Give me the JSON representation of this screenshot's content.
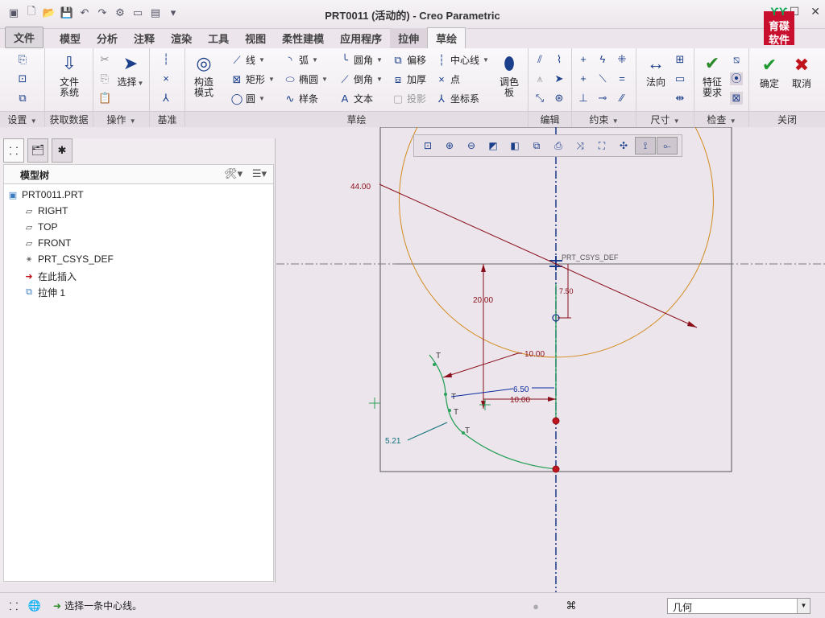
{
  "window": {
    "title": "PRT0011 (活动的) - Creo Parametric"
  },
  "logo": {
    "text": "育碟软件"
  },
  "tabs": [
    {
      "label": "文件",
      "kind": "file"
    },
    {
      "label": "模型"
    },
    {
      "label": "分析"
    },
    {
      "label": "注释"
    },
    {
      "label": "渲染"
    },
    {
      "label": "工具"
    },
    {
      "label": "视图"
    },
    {
      "label": "柔性建模"
    },
    {
      "label": "应用程序"
    },
    {
      "label": "拉伸",
      "kind": "ctx"
    },
    {
      "label": "草绘",
      "kind": "active"
    }
  ],
  "ribbon": {
    "groups": {
      "setup": "设置",
      "getdata": "获取数据",
      "ops": "操作",
      "datum": "基准",
      "sketch": "草绘",
      "edit": "编辑",
      "constrain": "约束",
      "dimension": "尺寸",
      "inspect": "检查",
      "close": "关闭"
    },
    "buttons": {
      "file_system": "文件\n系统",
      "select": "选择",
      "construction": "构造\n模式",
      "line": "线",
      "rect": "矩形",
      "circle": "圆",
      "arc": "弧",
      "ellipse": "椭圆",
      "spline": "样条",
      "fillet": "圆角",
      "chamfer": "倒角",
      "text": "文本",
      "offset": "偏移",
      "thicken": "加厚",
      "project": "投影",
      "centerline": "中心线",
      "point": "点",
      "coordsys": "坐标系",
      "palette": "调色\n板",
      "normal": "法向",
      "feature_req": "特征\n要求",
      "ok": "确定",
      "cancel": "取消"
    }
  },
  "model_tree": {
    "title": "模型树",
    "items": [
      {
        "label": "PRT0011.PRT",
        "icon": "part-icon"
      },
      {
        "label": "RIGHT",
        "icon": "plane-icon"
      },
      {
        "label": "TOP",
        "icon": "plane-icon"
      },
      {
        "label": "FRONT",
        "icon": "plane-icon"
      },
      {
        "label": "PRT_CSYS_DEF",
        "icon": "csys-icon"
      },
      {
        "label": "在此插入",
        "icon": "insert-arrow-icon"
      },
      {
        "label": "拉伸 1",
        "icon": "extrude-icon"
      }
    ]
  },
  "sketch": {
    "csys_label": "PRT_CSYS_DEF",
    "dims": {
      "d44": "44.00",
      "d20": "20.00",
      "d750": "7.50",
      "d10a": "10.00",
      "d650": "6.50",
      "d10b": "10.00",
      "d521": "5.21"
    },
    "tangent_marks": [
      "T",
      "T",
      "T",
      "T"
    ]
  },
  "status": {
    "message": "选择一条中心线。",
    "filter": "几何"
  },
  "colors": {
    "sketch_orange": "#d38b1f",
    "dim_red": "#8a0f1a",
    "dim_blue": "#0a2a9e",
    "green_geom": "#2aa15a",
    "centerline": "#1a3a8a",
    "canvas_bg": "#ece5ec"
  }
}
